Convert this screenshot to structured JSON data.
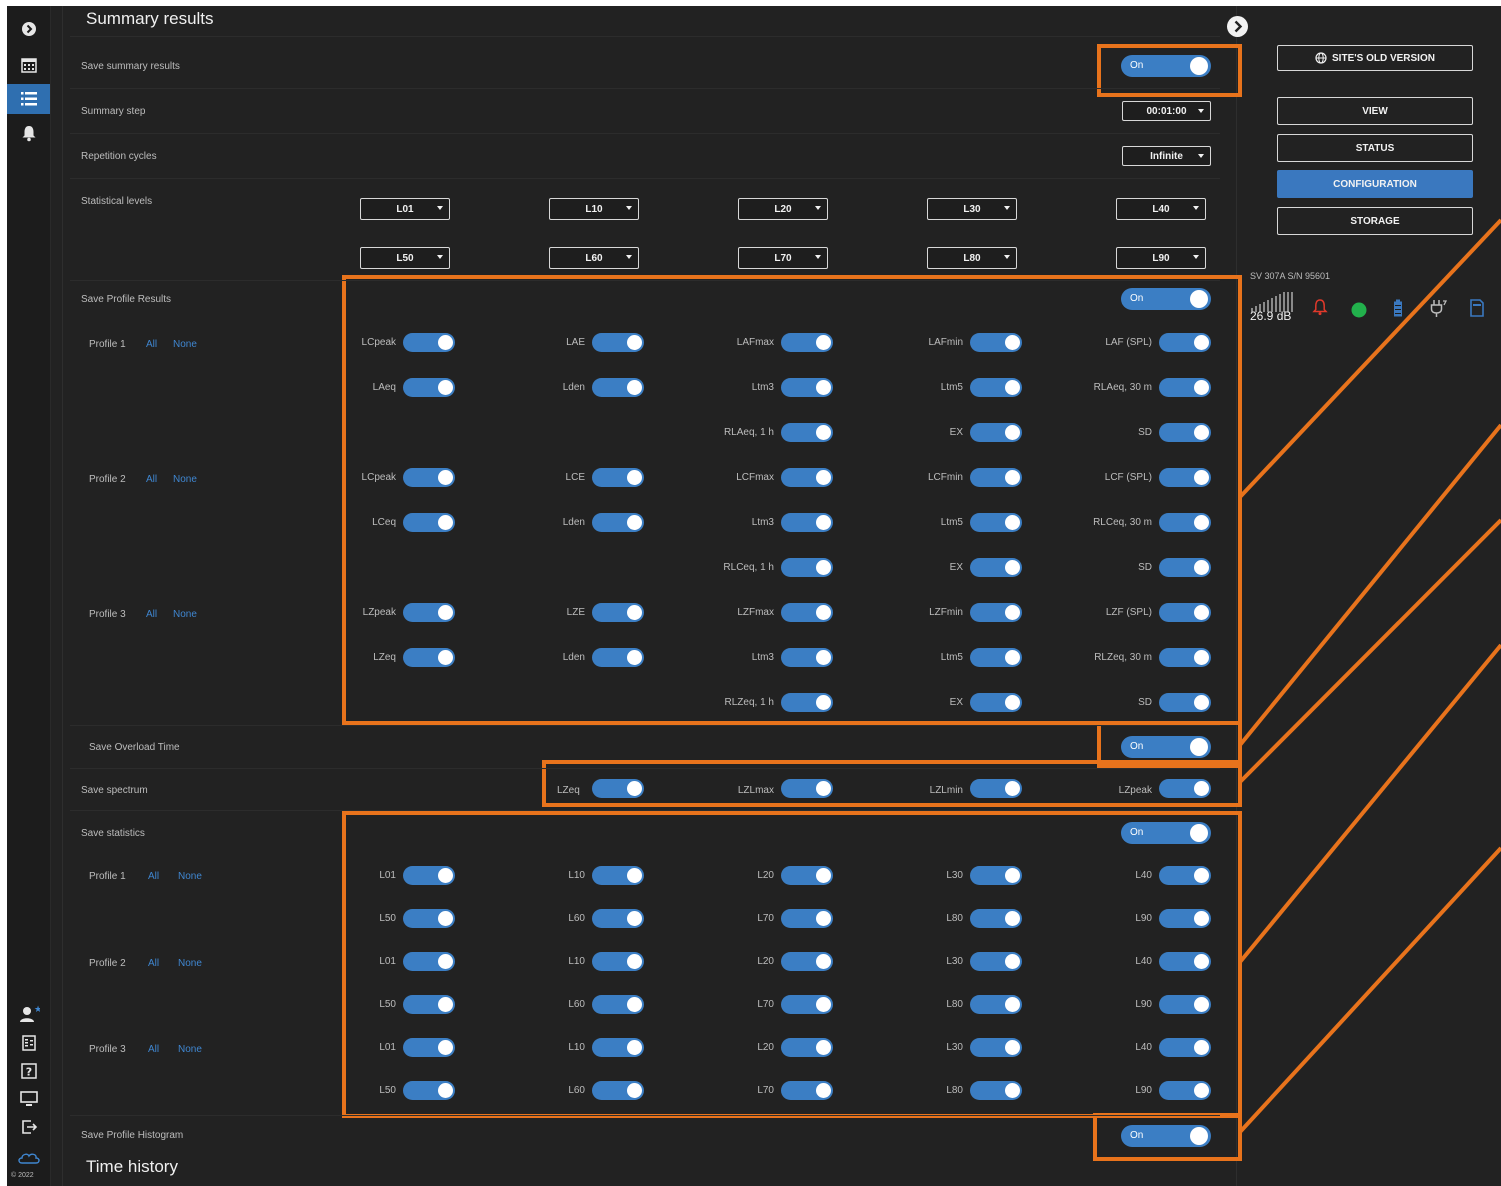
{
  "sections": {
    "summary_title": "Summary results",
    "time_history_title": "Time history"
  },
  "rows": {
    "save_summary": "Save summary results",
    "summary_step": "Summary step",
    "repetition_cycles": "Repetition cycles",
    "statistical_levels": "Statistical levels",
    "save_profile_results": "Save Profile Results",
    "save_overload_time": "Save Overload Time",
    "save_spectrum": "Save spectrum",
    "save_statistics": "Save statistics",
    "save_profile_histogram": "Save Profile Histogram"
  },
  "switch_label": "On",
  "selects": {
    "summary_step": "00:01:00",
    "repetition_cycles": "Infinite",
    "statistical_levels": [
      "L01",
      "L10",
      "L20",
      "L30",
      "L40",
      "L50",
      "L60",
      "L70",
      "L80",
      "L90"
    ]
  },
  "profiles": {
    "p1": "Profile 1",
    "p2": "Profile 2",
    "p3": "Profile 3",
    "all": "All",
    "none": "None"
  },
  "profile_results": {
    "rows": [
      [
        "LCpeak",
        "LAE",
        "LAFmax",
        "LAFmin",
        "LAF (SPL)"
      ],
      [
        "LAeq",
        "Lden",
        "Ltm3",
        "Ltm5",
        "RLAeq, 30 m"
      ],
      [
        "",
        "",
        "RLAeq, 1 h",
        "EX",
        "SD"
      ],
      [
        "LCpeak",
        "LCE",
        "LCFmax",
        "LCFmin",
        "LCF (SPL)"
      ],
      [
        "LCeq",
        "Lden",
        "Ltm3",
        "Ltm5",
        "RLCeq, 30 m"
      ],
      [
        "",
        "",
        "RLCeq, 1 h",
        "EX",
        "SD"
      ],
      [
        "LZpeak",
        "LZE",
        "LZFmax",
        "LZFmin",
        "LZF (SPL)"
      ],
      [
        "LZeq",
        "Lden",
        "Ltm3",
        "Ltm5",
        "RLZeq, 30 m"
      ],
      [
        "",
        "",
        "RLZeq, 1 h",
        "EX",
        "SD"
      ]
    ]
  },
  "spectrum": [
    "",
    "LZeq",
    "LZLmax",
    "LZLmin",
    "LZpeak"
  ],
  "statistics": {
    "rows": [
      [
        "L01",
        "L10",
        "L20",
        "L30",
        "L40"
      ],
      [
        "L50",
        "L60",
        "L70",
        "L80",
        "L90"
      ],
      [
        "L01",
        "L10",
        "L20",
        "L30",
        "L40"
      ],
      [
        "L50",
        "L60",
        "L70",
        "L80",
        "L90"
      ],
      [
        "L01",
        "L10",
        "L20",
        "L30",
        "L40"
      ],
      [
        "L50",
        "L60",
        "L70",
        "L80",
        "L90"
      ]
    ]
  },
  "right_panel": {
    "old_version": "SITE'S OLD VERSION",
    "view": "VIEW",
    "status": "STATUS",
    "configuration": "CONFIGURATION",
    "storage": "STORAGE",
    "device": "SV 307A S/N 95601",
    "level": "26.9 dB"
  },
  "footer": "© 2022",
  "colors": {
    "accent": "#3a78bf",
    "toggle": "#3b7ec4",
    "highlight": "#e8731c",
    "status_green": "#22b14c",
    "alarm_red": "#e0392b",
    "link": "#3f86d0"
  },
  "icons": [
    "expand-icon",
    "calendar-icon",
    "list-icon",
    "bell-icon",
    "user-icon",
    "report-icon",
    "help-icon",
    "monitor-icon",
    "logout-icon",
    "cloud-icon",
    "collapse-icon",
    "globe-icon",
    "signal-icon",
    "alarm-icon",
    "status-dot-icon",
    "battery-icon",
    "plug-icon",
    "memory-card-icon"
  ]
}
